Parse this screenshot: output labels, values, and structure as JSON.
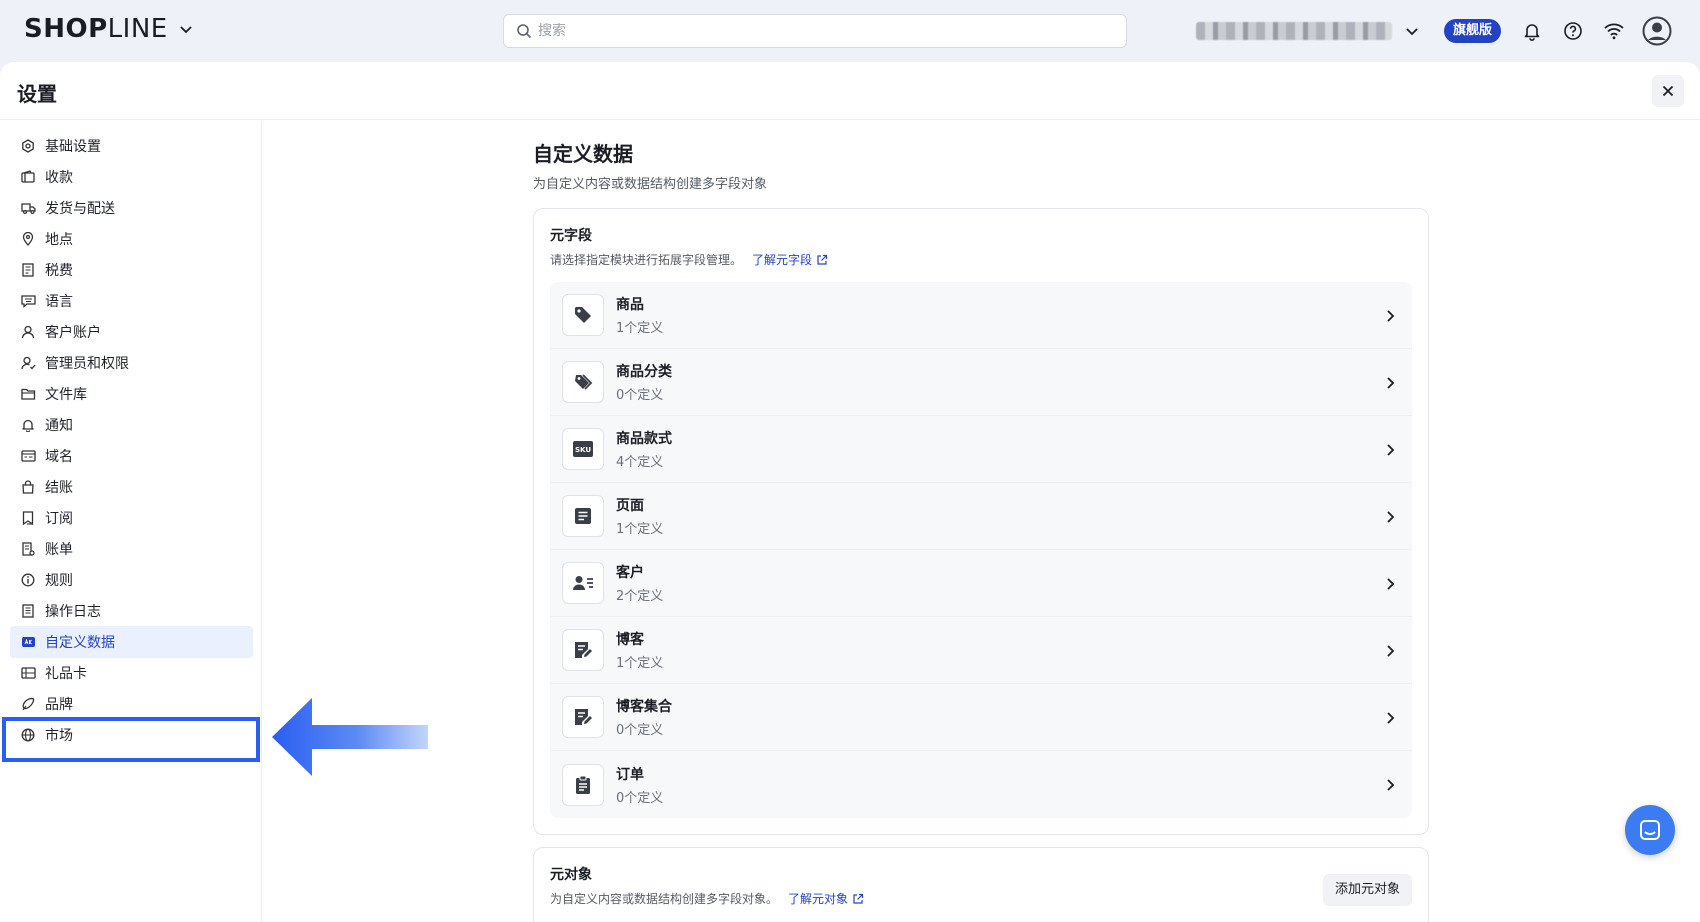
{
  "topbar": {
    "logo_bold": "SH",
    "logo_o": "O",
    "logo_p": "P",
    "logo_rest": "LINE",
    "search_placeholder": "搜索",
    "plan_badge": "旗舰版"
  },
  "panel": {
    "title": "设置"
  },
  "sidebar": {
    "items": [
      {
        "label": "基础设置",
        "icon": "gear-icon"
      },
      {
        "label": "收款",
        "icon": "wallet-icon"
      },
      {
        "label": "发货与配送",
        "icon": "truck-icon"
      },
      {
        "label": "地点",
        "icon": "location-pin-icon"
      },
      {
        "label": "税费",
        "icon": "receipt-icon"
      },
      {
        "label": "语言",
        "icon": "language-icon"
      },
      {
        "label": "客户账户",
        "icon": "person-icon"
      },
      {
        "label": "管理员和权限",
        "icon": "user-permissions-icon"
      },
      {
        "label": "文件库",
        "icon": "folder-icon"
      },
      {
        "label": "通知",
        "icon": "bell-icon"
      },
      {
        "label": "域名",
        "icon": "domain-icon"
      },
      {
        "label": "结账",
        "icon": "bag-icon"
      },
      {
        "label": "订阅",
        "icon": "bookmark-icon"
      },
      {
        "label": "账单",
        "icon": "bill-icon"
      },
      {
        "label": "规则",
        "icon": "info-icon"
      },
      {
        "label": "操作日志",
        "icon": "log-icon"
      },
      {
        "label": "自定义数据",
        "icon": "custom-data-icon"
      },
      {
        "label": "礼品卡",
        "icon": "gift-card-icon"
      },
      {
        "label": "品牌",
        "icon": "brand-icon"
      },
      {
        "label": "市场",
        "icon": "globe-icon"
      }
    ],
    "active_index": 16
  },
  "content": {
    "title": "自定义数据",
    "description": "为自定义内容或数据结构创建多字段对象",
    "metafields": {
      "title": "元字段",
      "description": "请选择指定模块进行拓展字段管理。",
      "link": "了解元字段",
      "rows": [
        {
          "label": "商品",
          "sub": "1个定义",
          "icon": "tag-icon"
        },
        {
          "label": "商品分类",
          "sub": "0个定义",
          "icon": "tags-icon"
        },
        {
          "label": "商品款式",
          "sub": "4个定义",
          "icon": "sku-icon",
          "icon_text": "SKU"
        },
        {
          "label": "页面",
          "sub": "1个定义",
          "icon": "page-icon"
        },
        {
          "label": "客户",
          "sub": "2个定义",
          "icon": "customer-icon"
        },
        {
          "label": "博客",
          "sub": "1个定义",
          "icon": "blog-edit-icon"
        },
        {
          "label": "博客集合",
          "sub": "0个定义",
          "icon": "blog-collection-icon"
        },
        {
          "label": "订单",
          "sub": "0个定义",
          "icon": "clipboard-icon"
        }
      ]
    },
    "metaobjects": {
      "title": "元对象",
      "description": "为自定义内容或数据结构创建多字段对象。",
      "link": "了解元对象",
      "add_button": "添加元对象"
    }
  }
}
